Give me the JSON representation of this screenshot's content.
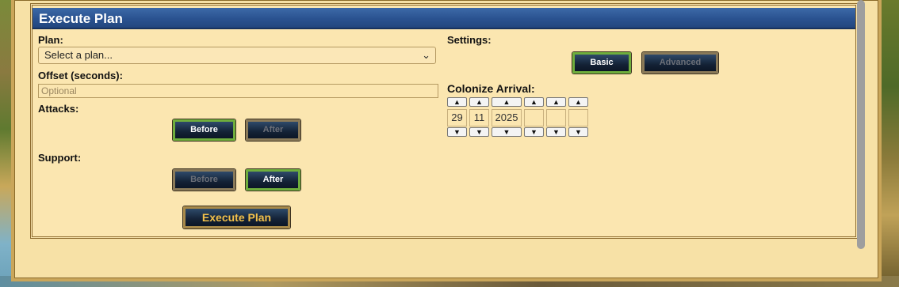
{
  "window": {
    "title": "Execute Plan"
  },
  "plan": {
    "label": "Plan:",
    "select_value": "Select a plan..."
  },
  "offset": {
    "label": "Offset (seconds):",
    "placeholder": "Optional"
  },
  "attacks": {
    "label": "Attacks:",
    "before_label": "Before",
    "after_label": "After",
    "selected": "Before"
  },
  "support": {
    "label": "Support:",
    "before_label": "Before",
    "after_label": "After",
    "selected": "After"
  },
  "execute": {
    "label": "Execute Plan"
  },
  "settings": {
    "label": "Settings:",
    "basic_label": "Basic",
    "advanced_label": "Advanced",
    "selected": "Basic"
  },
  "colonize": {
    "label": "Colonize Arrival:",
    "up_arrow": "▲",
    "down_arrow": "▼",
    "fields": [
      "29",
      "11",
      "2025",
      "",
      "",
      ""
    ]
  },
  "colors": {
    "title_bar": "#2a5290",
    "parchment": "#fbe6b0",
    "active_border": "#6fae3c",
    "execute_text": "#f2c04a"
  }
}
